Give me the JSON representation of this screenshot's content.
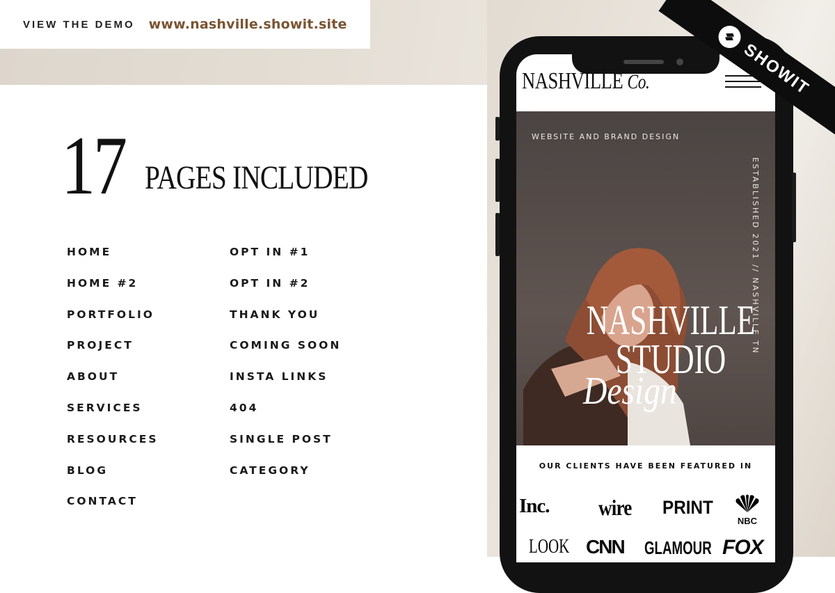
{
  "demo": {
    "label": "VIEW THE DEMO",
    "url": "www.nashville.showit.site"
  },
  "title": {
    "number": "17",
    "text": "PAGES INCLUDED"
  },
  "pages_left": [
    "HOME",
    "HOME #2",
    "PORTFOLIO",
    "PROJECT",
    "ABOUT",
    "SERVICES",
    "RESOURCES",
    "BLOG",
    "CONTACT"
  ],
  "pages_right": [
    "OPT IN #1",
    "OPT IN #2",
    "THANK YOU",
    "COMING SOON",
    "INSTA LINKS",
    "404",
    "SINGLE POST",
    "CATEGORY"
  ],
  "phone": {
    "brand": "NASHVILLE",
    "brand_suffix": "Co.",
    "hero_subtitle": "WEBSITE AND BRAND DESIGN",
    "hero_vertical": "ESTABLISHED 2021 // NASHVILLE TN",
    "hero_line1": "NASHVILLE",
    "hero_line2": "STUDIO",
    "hero_line3": "Design",
    "featured_heading": "OUR CLIENTS HAVE BEEN FEATURED IN",
    "logos": {
      "inc": "Inc.",
      "wire": "wire",
      "print": "PRINT",
      "nbc": "NBC",
      "look": "LOOK",
      "cnn": "CNN",
      "glamour": "GLAMOUR",
      "fox": "FOX"
    }
  },
  "ribbon": {
    "text": "SHOWIT",
    "icon": "showit-logo-icon"
  },
  "colors": {
    "accent_brown": "#7a5432",
    "beige": "#e4ded5",
    "ribbon": "#0d0d0d"
  }
}
